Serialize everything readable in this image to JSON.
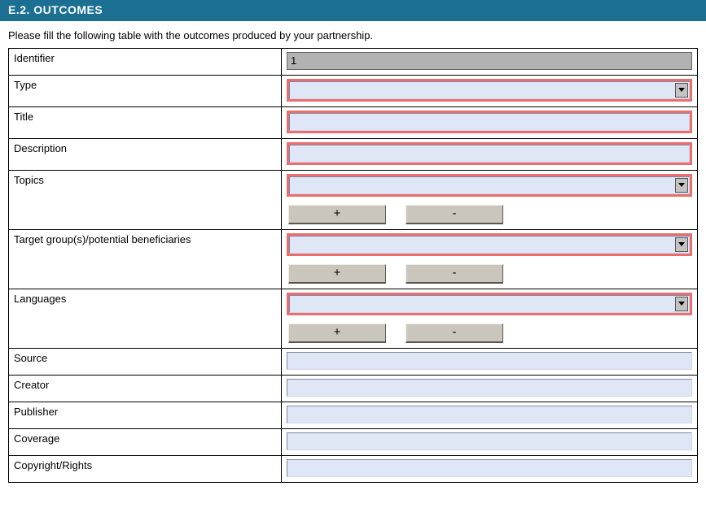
{
  "section": {
    "header": "E.2. OUTCOMES",
    "instruction": "Please fill the following table with the outcomes produced by your partnership."
  },
  "buttons": {
    "add": "+",
    "remove": "-"
  },
  "rows": {
    "identifier": {
      "label": "Identifier",
      "value": "1"
    },
    "type": {
      "label": "Type",
      "value": ""
    },
    "title": {
      "label": "Title",
      "value": ""
    },
    "description": {
      "label": "Description",
      "value": ""
    },
    "topics": {
      "label": "Topics",
      "value": ""
    },
    "target": {
      "label": "Target group(s)/potential beneficiaries",
      "value": ""
    },
    "languages": {
      "label": "Languages",
      "value": ""
    },
    "source": {
      "label": "Source",
      "value": ""
    },
    "creator": {
      "label": "Creator",
      "value": ""
    },
    "publisher": {
      "label": "Publisher",
      "value": ""
    },
    "coverage": {
      "label": "Coverage",
      "value": ""
    },
    "copyright": {
      "label": "Copyright/Rights",
      "value": ""
    }
  }
}
